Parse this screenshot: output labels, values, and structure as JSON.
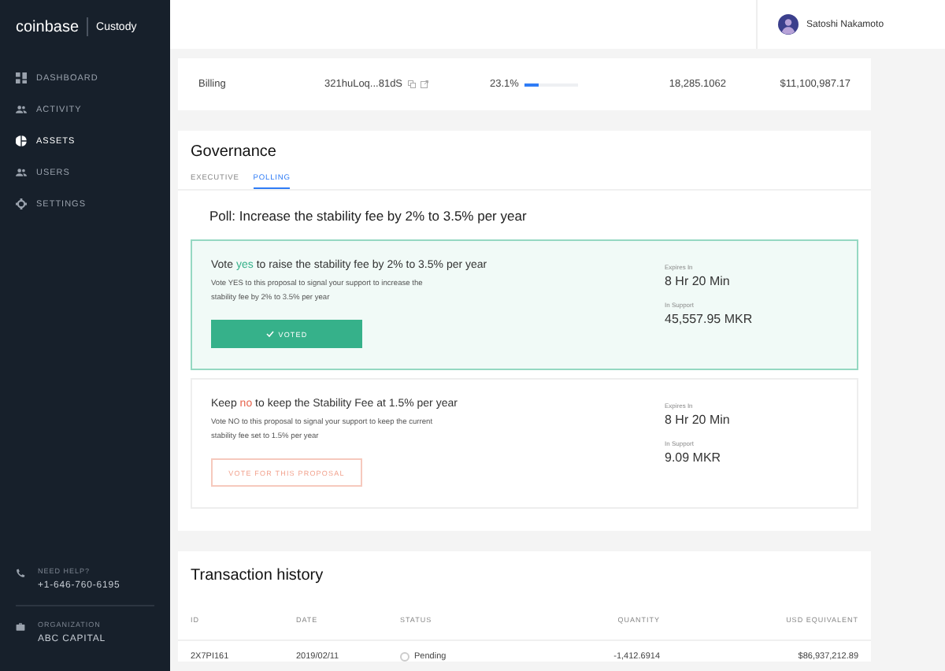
{
  "brand": {
    "logo": "coinbase",
    "product": "Custody"
  },
  "nav": [
    {
      "label": "DASHBOARD",
      "selected": false
    },
    {
      "label": "ACTIVITY",
      "selected": false
    },
    {
      "label": "ASSETS",
      "selected": true
    },
    {
      "label": "USERS",
      "selected": false
    },
    {
      "label": "SETTINGS",
      "selected": false
    }
  ],
  "help": {
    "label": "NEED HELP?",
    "phone": "+1-646-760-6195"
  },
  "organization": {
    "label": "ORGANIZATION",
    "name": "ABC CAPITAL"
  },
  "user": {
    "name": "Satoshi Nakamoto"
  },
  "asset_row": {
    "name": "Billing",
    "address": "321huLoq...81dS",
    "percent": "23.1%",
    "level": 0.25,
    "quantity": "18,285.1062",
    "value": "$11,100,987.17"
  },
  "governance": {
    "title": "Governance",
    "tabs": [
      {
        "label": "EXECUTIVE",
        "selected": false
      },
      {
        "label": "POLLING",
        "selected": true
      }
    ],
    "poll_title": "Poll: Increase the stability fee by 2% to 3.5% per year",
    "options": [
      {
        "heading_start": "Vote",
        "vote_word": "yes",
        "heading_end": "to raise the stability fee by 2% to 3.5% per year",
        "kind": "yes",
        "description": "Vote YES to this proposal to signal your support to increase the stability fee by 2% to 3.5% per year",
        "voted": true,
        "button": "VOTED",
        "expires_label": "Expires In",
        "expires": "8 Hr 20 Min",
        "support_label": "In Support",
        "support": "45,557.95 MKR"
      },
      {
        "heading_start": "Keep",
        "vote_word": "no",
        "heading_end": "to keep the Stability Fee at 1.5% per year",
        "kind": "no",
        "description": "Vote NO to this proposal to signal your support to keep the current stability fee set to 1.5% per year",
        "voted": false,
        "button": "VOTE FOR THIS PROPOSAL",
        "expires_label": "Expires In",
        "expires": "8 Hr 20 Min",
        "support_label": "In Support",
        "support": "9.09 MKR"
      }
    ]
  },
  "transactions": {
    "title": "Transaction history",
    "columns": [
      "ID",
      "DATE",
      "STATUS",
      "QUANTITY",
      "USD EQUIVALENT"
    ],
    "rows": [
      {
        "id": "2X7PI161",
        "date": "2019/02/11",
        "status": "Pending",
        "quantity": "-1,412.6914",
        "usd": "$86,937,212.89"
      }
    ]
  }
}
